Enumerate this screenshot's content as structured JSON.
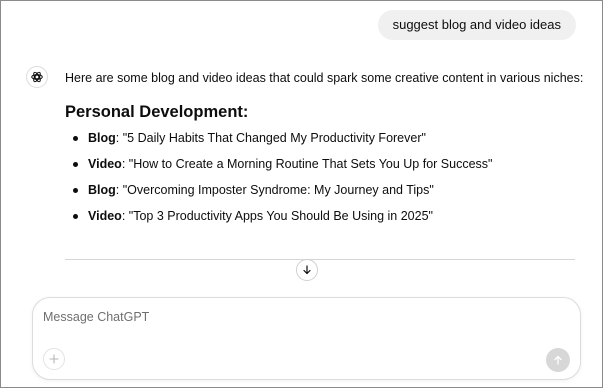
{
  "conversation": {
    "user_message": "suggest blog and video ideas",
    "assistant": {
      "intro": "Here are some blog and video ideas that could spark some creative content in various niches:",
      "section_heading": "Personal Development:",
      "items": [
        {
          "type": "Blog",
          "text": ": \"5 Daily Habits That Changed My Productivity Forever\""
        },
        {
          "type": "Video",
          "text": ": \"How to Create a Morning Routine That Sets You Up for Success\""
        },
        {
          "type": "Blog",
          "text": ": \"Overcoming Imposter Syndrome: My Journey and Tips\""
        },
        {
          "type": "Video",
          "text": ": \"Top 3 Productivity Apps You Should Be Using in 2025\""
        }
      ]
    }
  },
  "composer": {
    "placeholder": "Message ChatGPT",
    "value": ""
  },
  "icons": {
    "avatar": "openai-logo-icon",
    "scroll": "arrow-down-icon",
    "attach": "plus-icon",
    "send": "arrow-up-icon"
  },
  "colors": {
    "user_bubble": "#f0f0f0",
    "send_button_disabled": "#d7d7d7",
    "text": "#0d0d0d"
  }
}
